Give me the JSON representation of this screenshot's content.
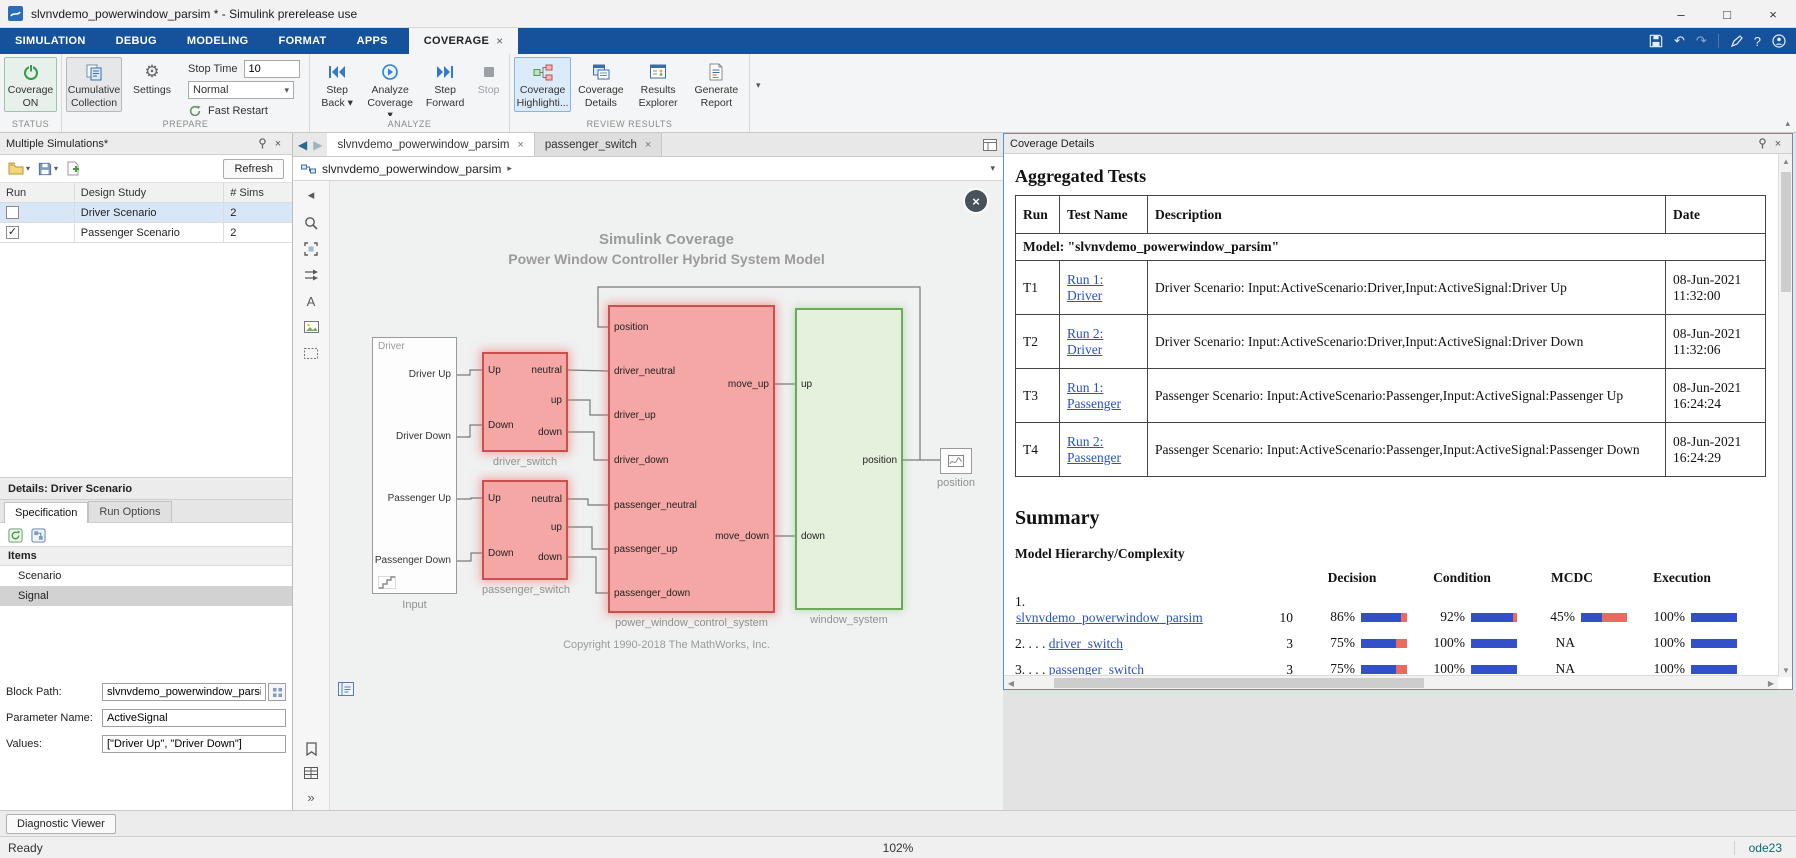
{
  "window": {
    "title": "slvnvdemo_powerwindow_parsim * - Simulink prerelease use",
    "minimize": "–",
    "maximize": "□",
    "close": "×"
  },
  "glyphs": {
    "dropdown": "▾",
    "collapse": "▴",
    "back": "◀",
    "forward": "▶",
    "crumb": "▸",
    "chevrons": "»",
    "hide": "◂",
    "undo": "↶",
    "redo": "↷",
    "help": "?",
    "check": "✓",
    "close": "×",
    "up": "▲",
    "down": "▼",
    "left": "◀",
    "right": "▶",
    "annotation": "A",
    "gear": "⚙"
  },
  "tabbar": {
    "tabs": [
      "SIMULATION",
      "DEBUG",
      "MODELING",
      "FORMAT",
      "APPS"
    ],
    "active": "COVERAGE"
  },
  "ribbon": {
    "labels": [
      "STATUS",
      "PREPARE",
      "ANALYZE",
      "REVIEW RESULTS"
    ],
    "coverage_on_l1": "Coverage",
    "coverage_on_l2": "ON",
    "cumulative_l1": "Cumulative",
    "cumulative_l2": "Collection",
    "settings": "Settings",
    "stop_time_label": "Stop Time",
    "stop_time_value": "10",
    "sim_mode": "Normal",
    "fast_restart": "Fast Restart",
    "step_back_l1": "Step",
    "step_back_l2": "Back ▾",
    "analyze_l1": "Analyze",
    "analyze_l2": "Coverage ▾",
    "step_forward_l1": "Step",
    "step_forward_l2": "Forward",
    "stop": "Stop",
    "cov_highlight_l1": "Coverage",
    "cov_highlight_l2": "Highlighti...",
    "cov_details_l1": "Coverage",
    "cov_details_l2": "Details",
    "results_explorer_l1": "Results",
    "results_explorer_l2": "Explorer",
    "generate_report_l1": "Generate",
    "generate_report_l2": "Report"
  },
  "left_panel": {
    "title": "Multiple Simulations*",
    "refresh": "Refresh",
    "columns": [
      "Run",
      "Design Study",
      "# Sims"
    ],
    "rows": [
      {
        "check": "",
        "study": "Driver Scenario",
        "sims": "2"
      },
      {
        "check": "✓",
        "study": "Passenger Scenario",
        "sims": "2"
      }
    ],
    "details_title": "Details: Driver Scenario",
    "tab_specification": "Specification",
    "tab_run_options": "Run Options",
    "items_header": "Items",
    "items": [
      "Scenario",
      "Signal"
    ],
    "fields": [
      {
        "label": "Block Path:",
        "value": "slvnvdemo_powerwindow_parsim/"
      },
      {
        "label": "Parameter Name:",
        "value": "ActiveSignal"
      },
      {
        "label": "Values:",
        "value": "[\"Driver Up\", \"Driver Down\"]"
      }
    ]
  },
  "canvas": {
    "tabs": [
      {
        "label": "slvnvdemo_powerwindow_parsim"
      },
      {
        "label": "passenger_switch"
      }
    ],
    "breadcrumb": "slvnvdemo_powerwindow_parsim",
    "title1": "Simulink Coverage",
    "title2": "Power Window Controller Hybrid System Model",
    "copyright": "Copyright 1990-2018 The MathWorks, Inc.",
    "input": {
      "group": "Driver",
      "name": "Input",
      "ports": [
        "Driver Up",
        "Driver Down",
        "Passenger Up",
        "Passenger Down"
      ]
    },
    "driver_switch": {
      "name": "driver_switch",
      "left": [
        "Up",
        "Down"
      ],
      "right": [
        "neutral",
        "up",
        "down"
      ]
    },
    "passenger_switch": {
      "name": "passenger_switch",
      "left": [
        "Up",
        "Down"
      ],
      "right": [
        "neutral",
        "up",
        "down"
      ]
    },
    "control": {
      "name": "power_window_control_system",
      "left": [
        "position",
        "driver_neutral",
        "driver_up",
        "driver_down",
        "passenger_neutral",
        "passenger_up",
        "passenger_down"
      ],
      "right": [
        "move_up",
        "move_down"
      ]
    },
    "window_system": {
      "name": "window_system",
      "left": [
        "up",
        "down"
      ],
      "right": [
        "position"
      ]
    },
    "outport": {
      "name": "position"
    }
  },
  "coverage": {
    "panel_title": "Coverage Details",
    "heading": "Aggregated Tests",
    "columns": [
      "Run",
      "Test Name",
      "Description",
      "Date"
    ],
    "model_row": "Model: \"slvnvdemo_powerwindow_parsim\"",
    "rows": [
      {
        "run": "T1",
        "link": "Run 1: Driver",
        "desc": "Driver Scenario: Input:ActiveScenario:Driver,Input:ActiveSignal:Driver Up",
        "date": "08-Jun-2021 11:32:00"
      },
      {
        "run": "T2",
        "link": "Run 2: Driver",
        "desc": "Driver Scenario: Input:ActiveScenario:Driver,Input:ActiveSignal:Driver Down",
        "date": "08-Jun-2021 11:32:06"
      },
      {
        "run": "T3",
        "link": "Run 1: Passenger",
        "desc": "Passenger Scenario: Input:ActiveScenario:Passenger,Input:ActiveSignal:Passenger Up",
        "date": "08-Jun-2021 16:24:24"
      },
      {
        "run": "T4",
        "link": "Run 2: Passenger",
        "desc": "Passenger Scenario: Input:ActiveScenario:Passenger,Input:ActiveSignal:Passenger Down",
        "date": "08-Jun-2021 16:24:29"
      }
    ],
    "summary_heading": "Summary",
    "hierarchy_heading": "Model Hierarchy/Complexity",
    "metric_columns": [
      "Decision",
      "Condition",
      "MCDC",
      "Execution"
    ],
    "hierarchy": [
      {
        "index": "1.",
        "link": "slvnvdemo_powerwindow_parsim",
        "complexity": "10",
        "decision": "86%",
        "decision_pct": 86,
        "condition": "92%",
        "condition_pct": 92,
        "mcdc": "45%",
        "mcdc_pct": 45,
        "execution": "100%",
        "execution_pct": 100
      },
      {
        "index": "2. . . .",
        "link": "driver_switch",
        "complexity": "3",
        "decision": "75%",
        "decision_pct": 75,
        "condition": "100%",
        "condition_pct": 100,
        "mcdc": "NA",
        "mcdc_pct": null,
        "execution": "100%",
        "execution_pct": 100
      },
      {
        "index": "3. . . .",
        "link": "passenger_switch",
        "complexity": "3",
        "decision": "75%",
        "decision_pct": 75,
        "condition": "100%",
        "condition_pct": 100,
        "mcdc": "NA",
        "mcdc_pct": null,
        "execution": "100%",
        "execution_pct": 100
      }
    ]
  },
  "status": {
    "diagnostic_viewer": "Diagnostic Viewer",
    "ready": "Ready",
    "zoom": "102%",
    "solver": "ode23"
  },
  "colors": {
    "tabbar_blue": "#16519b",
    "block_pink": "#f4a7a4",
    "block_pink_border": "#c9504c",
    "block_green": "#e4f1dc",
    "block_green_border": "#6aaa5a",
    "bar_fill_blue": "#3350c8",
    "bar_miss_red": "#e96a5f",
    "link_blue": "#2b50c8"
  }
}
